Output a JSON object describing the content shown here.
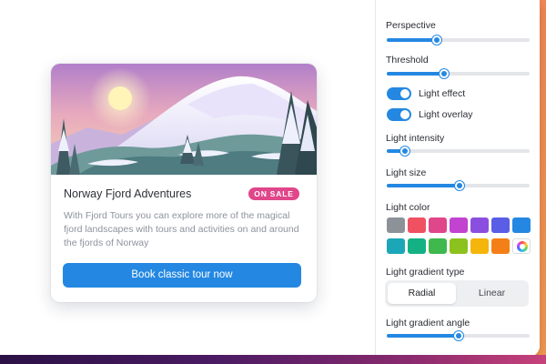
{
  "card": {
    "title": "Norway Fjord Adventures",
    "badge": "ON SALE",
    "description": "With Fjord Tours you can explore more of the magical fjord landscapes with tours and activities on and around the fjords of Norway",
    "button_label": "Book classic tour now"
  },
  "panel": {
    "perspective": {
      "label": "Perspective",
      "value_fraction": 0.35
    },
    "threshold": {
      "label": "Threshold",
      "value_fraction": 0.4
    },
    "light_effect": {
      "label": "Light effect",
      "on": true
    },
    "light_overlay": {
      "label": "Light overlay",
      "on": true
    },
    "light_intensity": {
      "label": "Light intensity",
      "value_fraction": 0.13
    },
    "light_size": {
      "label": "Light size",
      "value_fraction": 0.51
    },
    "light_color": {
      "label": "Light color",
      "swatches_row1": [
        "#8d9299",
        "#ef5160",
        "#e0468a",
        "#c143d0",
        "#8b4fe0",
        "#5a5de6",
        "#2488e2"
      ],
      "swatches_row2": [
        "#1ba7b8",
        "#14b184",
        "#3fb84e",
        "#8cc21e",
        "#f5b50a",
        "#f57f17"
      ],
      "custom_icon": "color-wheel-icon"
    },
    "gradient_type": {
      "label": "Light gradient type",
      "options": [
        "Radial",
        "Linear"
      ],
      "selected": "Radial"
    },
    "gradient_angle": {
      "label": "Light gradient angle",
      "value_fraction": 0.5
    }
  },
  "colors": {
    "accent": "#2488e2",
    "badge": "#e0468a"
  }
}
